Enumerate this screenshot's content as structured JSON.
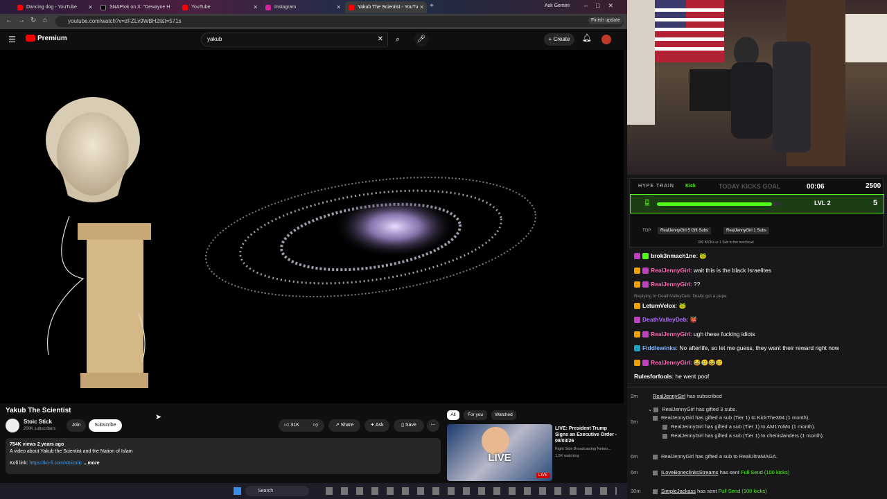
{
  "browser": {
    "tabs": [
      {
        "label": "Dancing dog - YouTube",
        "active": false
      },
      {
        "label": "SNAPtok on X: \"Dewayne H",
        "active": false
      },
      {
        "label": "YouTube",
        "active": false
      },
      {
        "label": "Instagram",
        "active": false
      },
      {
        "label": "Yakub The Scientist - YouTu",
        "active": true
      }
    ],
    "right_label": "Ask Gemini",
    "url": "youtube.com/watch?v=zFZLv9WBH2I&t=571s",
    "finish_update": "Finish update"
  },
  "youtube": {
    "brand": "Premium",
    "search_value": "yakub",
    "create_label": "Create"
  },
  "video": {
    "title": "Yakub The Scientist",
    "channel": "Stoic Stick",
    "subscribers": "200K subscribers",
    "join_label": "Join",
    "subscribe_label": "Subscribe",
    "likes": "31K",
    "share_label": "Share",
    "ask_label": "Ask",
    "save_label": "Save",
    "views_age": "754K views  2 years ago",
    "description": "A video about Yakub the Scientist and the Nation of Islam",
    "kofi_prefix": "Kofi link: ",
    "kofi_link": "https://ko-fi.com/stoicstic",
    "more_label": "...more"
  },
  "recommendations": {
    "chips": [
      "All",
      "For you",
      "Watched"
    ],
    "item": {
      "title": "LIVE: President Trump Signs an Executive Order - 08/03/26",
      "channel": "Right Side Broadcasting Netwo...",
      "watching": "1.5K watching",
      "live_badge": "LIVE",
      "thumb_text": "LIVE"
    }
  },
  "taskbar": {
    "search_label": "Search"
  },
  "overlay": {
    "hype_train": "HYPE TRAIN",
    "kick": "Kick",
    "kicks_goal": "TODAY KICKS GOAL",
    "timer": "00:06",
    "goal": "2500",
    "level": "LVL 2",
    "count": "5",
    "top_label": "TOP",
    "top1": "RealJennyGirl 5 Gift Subs",
    "top2": "RealJennyGirl 1 Subs",
    "next_level": "300 KICKs or 1 Sub to the next level",
    "hype_progress": 0.92
  },
  "chat": {
    "messages": [
      {
        "user": "brok3nmach1ne",
        "text": ":",
        "color": "#ffffff",
        "emote": true
      },
      {
        "user": "RealJennyGirl",
        "text": ": wait this is the black Israelites",
        "color": "#ff69b4"
      },
      {
        "user": "RealJennyGirl",
        "text": ": ??",
        "color": "#ff69b4"
      },
      {
        "user": "LetumVelox",
        "text": ":",
        "color": "#ffffff",
        "reply": "Replying to DeathValleyDeb: finally got a pepe",
        "emote": true
      },
      {
        "user": "DeathValleyDeb",
        "text": ":",
        "color": "#b16cff",
        "emote": true
      },
      {
        "user": "RealJennyGirl",
        "text": ": ugh these fucking idiots",
        "color": "#ff69b4"
      },
      {
        "user": "Fiddlewinks",
        "text": ": No afterlife, so let me guess, they want their reward right now",
        "color": "#7ab8ff"
      },
      {
        "user": "RealJennyGirl",
        "text": ": 😂🥲😂🥲",
        "color": "#ff69b4"
      },
      {
        "user": "Rulesforfools",
        "text": ": he went poof",
        "color": "#ffffff"
      }
    ],
    "events": [
      {
        "time": "2m",
        "user": "RealJennyGirl",
        "text": " has subscribed"
      },
      {
        "time": "",
        "user": "RealJennyGirl",
        "text": " has gifted 3 subs."
      },
      {
        "time": "5m",
        "user": "RealJennyGirl",
        "text": " has gifted a sub (Tier 1) to ",
        "target": "KickThe304",
        "tail": " (1 month)."
      },
      {
        "time": "",
        "user": "RealJennyGirl",
        "text": " has gifted a sub (Tier 1) to ",
        "target": "AM17oMo",
        "tail": " (1 month)."
      },
      {
        "time": "",
        "user": "RealJennyGirl",
        "text": " has gifted a sub (Tier 1) to ",
        "target": "chenislanders",
        "tail": " (1 month)."
      },
      {
        "time": "6m",
        "user": "RealJennyGirl",
        "text": " has gifted a sub to ",
        "target": "RealUltraMAGA",
        "tail": "."
      },
      {
        "time": "6m",
        "user": "ILoveBoneclinksStreams",
        "text": " has sent ",
        "target": "Full Send (100 kicks)",
        "tail": ""
      },
      {
        "time": "30m",
        "user": "SimpleJackass",
        "text": " has sent ",
        "target": "Full Send (100 kicks)",
        "tail": ""
      }
    ]
  }
}
